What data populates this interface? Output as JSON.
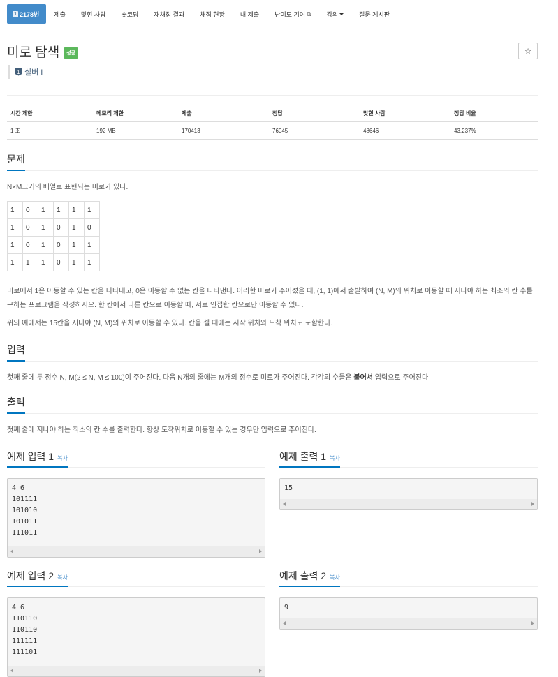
{
  "nav": {
    "active_icon": "1",
    "tabs": [
      "2178번",
      "제출",
      "맞힌 사람",
      "숏코딩",
      "재채점 결과",
      "채점 현황",
      "내 제출",
      "난이도 기여",
      "강의",
      "질문 게시판"
    ]
  },
  "problem": {
    "title": "미로 탐색",
    "status": "성공",
    "star": "☆",
    "tier_icon": "1",
    "tier": "실버 I"
  },
  "info": {
    "headers": [
      "시간 제한",
      "메모리 제한",
      "제출",
      "정답",
      "맞힌 사람",
      "정답 비율"
    ],
    "values": [
      "1 초",
      "192 MB",
      "170413",
      "76045",
      "48646",
      "43.237%"
    ]
  },
  "sections": {
    "problem_label": "문제",
    "problem_intro": "N×M크기의 배열로 표현되는 미로가 있다.",
    "maze": [
      [
        "1",
        "0",
        "1",
        "1",
        "1",
        "1"
      ],
      [
        "1",
        "0",
        "1",
        "0",
        "1",
        "0"
      ],
      [
        "1",
        "0",
        "1",
        "0",
        "1",
        "1"
      ],
      [
        "1",
        "1",
        "1",
        "0",
        "1",
        "1"
      ]
    ],
    "problem_p1": "미로에서 1은 이동할 수 있는 칸을 나타내고, 0은 이동할 수 없는 칸을 나타낸다. 이러한 미로가 주어졌을 때, (1, 1)에서 출발하여 (N, M)의 위치로 이동할 때 지나야 하는 최소의 칸 수를 구하는 프로그램을 작성하시오. 한 칸에서 다른 칸으로 이동할 때, 서로 인접한 칸으로만 이동할 수 있다.",
    "problem_p2": "위의 예에서는 15칸을 지나야 (N, M)의 위치로 이동할 수 있다. 칸을 셀 때에는 시작 위치와 도착 위치도 포함한다.",
    "input_label": "입력",
    "input_pre": "첫째 줄에 두 정수 N, M(2 ≤ N, M ≤ 100)이 주어진다. 다음 N개의 줄에는 M개의 정수로 미로가 주어진다. 각각의 수들은 ",
    "input_bold": "붙어서",
    "input_post": " 입력으로 주어진다.",
    "output_label": "출력",
    "output_text": "첫째 줄에 지나야 하는 최소의 칸 수를 출력한다. 항상 도착위치로 이동할 수 있는 경우만 입력으로 주어진다."
  },
  "samples": {
    "copy_label": "복사",
    "in1_label": "예제 입력 1",
    "in1_lines": [
      "4 6",
      "101111",
      "101010",
      "101011",
      "111011"
    ],
    "out1_label": "예제 출력 1",
    "out1_lines": [
      "15"
    ],
    "in2_label": "예제 입력 2",
    "in2_lines": [
      "4 6",
      "110110",
      "110110",
      "111111",
      "111101"
    ],
    "out2_label": "예제 출력 2",
    "out2_lines": [
      "9"
    ]
  }
}
